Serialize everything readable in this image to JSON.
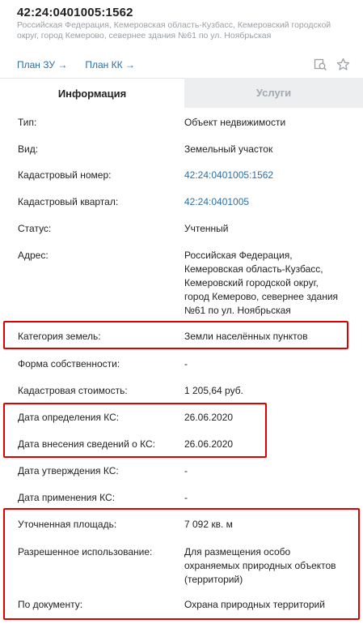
{
  "header": {
    "cad_number": "42:24:0401005:1562",
    "address": "Российская Федерация, Кемеровская область-Кузбасс, Кемеровский городской округ, город Кемерово, севернее здания №61 по ул. Ноябрьская"
  },
  "links": {
    "plan_zu": "План ЗУ →",
    "plan_kk": "План КК →"
  },
  "tabs": {
    "info": "Информация",
    "services": "Услуги"
  },
  "rows": [
    {
      "label": "Тип:",
      "value": "Объект недвижимости"
    },
    {
      "label": "Вид:",
      "value": "Земельный участок"
    },
    {
      "label": "Кадастровый номер:",
      "value": "42:24:0401005:1562"
    },
    {
      "label": "Кадастровый квартал:",
      "value": "42:24:0401005"
    },
    {
      "label": "Статус:",
      "value": "Учтенный"
    },
    {
      "label": "Адрес:",
      "value": "Российская Федерация, Кемеровская область-Кузбасс, Кемеровский городской округ, город Кемерово, севернее здания №61 по ул. Ноябрьская"
    },
    {
      "label": "Категория земель:",
      "value": "Земли населённых пунктов"
    },
    {
      "label": "Форма собственности:",
      "value": "-"
    },
    {
      "label": "Кадастровая стоимость:",
      "value": "1 205,64 руб."
    },
    {
      "label": "Дата определения КС:",
      "value": "26.06.2020"
    },
    {
      "label": "Дата внесения сведений о КС:",
      "value": "26.06.2020"
    },
    {
      "label": "Дата утверждения КС:",
      "value": "-"
    },
    {
      "label": "Дата применения КС:",
      "value": "-"
    },
    {
      "label": "Уточненная площадь:",
      "value": "7 092 кв. м"
    },
    {
      "label": "Разрешенное использование:",
      "value": "Для размещения особо охраняемых природных объектов (территорий)"
    },
    {
      "label": "По документу:",
      "value": "Охрана природных территорий"
    }
  ],
  "colors": {
    "link": "#2c6fa7",
    "highlight": "#e10000",
    "tab_inactive_bg": "#eceef0"
  },
  "icons": [
    "zoom-map-icon",
    "star-icon"
  ]
}
